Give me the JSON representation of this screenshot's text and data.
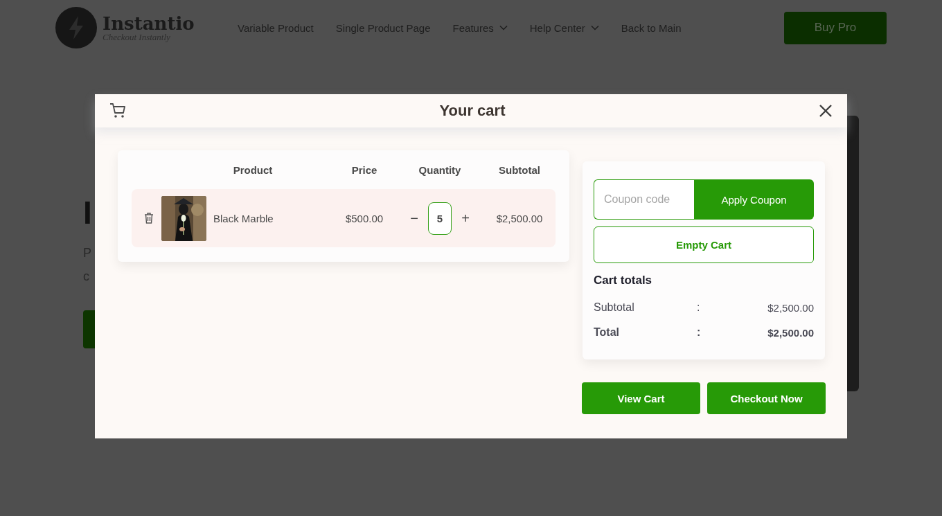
{
  "header": {
    "logo": {
      "name": "Instantio",
      "tagline": "Checkout Instantly"
    },
    "nav": [
      {
        "label": "Variable Product",
        "dropdown": false
      },
      {
        "label": "Single Product Page",
        "dropdown": false
      },
      {
        "label": "Features",
        "dropdown": true
      },
      {
        "label": "Help Center",
        "dropdown": true
      },
      {
        "label": "Back to Main",
        "dropdown": false
      }
    ],
    "cta": "Buy Pro"
  },
  "hero": {
    "heading_lines": [
      {
        "text": "I",
        "accent": false
      }
    ],
    "paragraph_lines": [
      "P",
      "c"
    ]
  },
  "cart": {
    "title": "Your cart",
    "columns": [
      "Product",
      "Price",
      "Quantity",
      "Subtotal"
    ],
    "items": [
      {
        "name": "Black Marble",
        "price": "$500.00",
        "minus": "−",
        "quantity": "5",
        "plus": "+",
        "subtotal": "$2,500.00"
      }
    ],
    "coupon": {
      "placeholder": "Coupon code",
      "button": "Apply Coupon"
    },
    "empty_button": "Empty Cart",
    "totals": {
      "title": "Cart totals",
      "rows": [
        {
          "label": "Subtotal",
          "separator": ":",
          "value": "$2,500.00",
          "kind": "normal"
        },
        {
          "label": "Total",
          "separator": ":",
          "value": "$2,500.00",
          "kind": "total"
        }
      ]
    },
    "actions": [
      "View Cart",
      "Checkout Now"
    ]
  }
}
